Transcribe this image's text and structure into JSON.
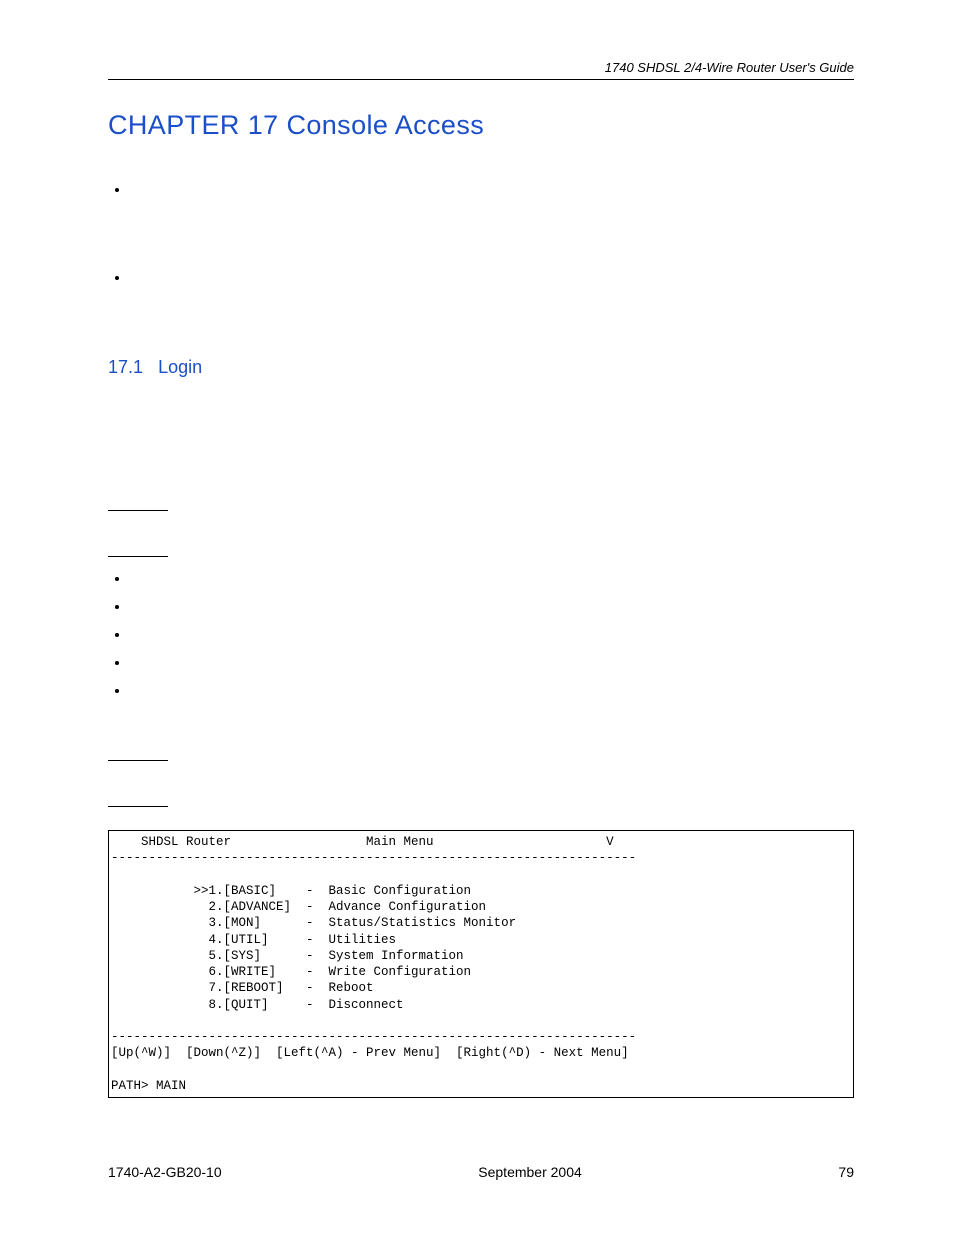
{
  "header": {
    "guide_title": "1740 SHDSL 2/4-Wire Router User's Guide"
  },
  "chapter": {
    "title": "CHAPTER 17   Console Access"
  },
  "section": {
    "number": "17.1",
    "title": "Login"
  },
  "terminal": {
    "device": "SHDSL Router",
    "menu_title": "Main Menu",
    "right_char": "V",
    "divider": "----------------------------------------------------------------------",
    "items": [
      {
        "num": "1",
        "tag": "[BASIC]",
        "desc": "Basic Configuration",
        "sel": true
      },
      {
        "num": "2",
        "tag": "[ADVANCE]",
        "desc": "Advance Configuration",
        "sel": false
      },
      {
        "num": "3",
        "tag": "[MON]",
        "desc": "Status/Statistics Monitor",
        "sel": false
      },
      {
        "num": "4",
        "tag": "[UTIL]",
        "desc": "Utilities",
        "sel": false
      },
      {
        "num": "5",
        "tag": "[SYS]",
        "desc": "System Information",
        "sel": false
      },
      {
        "num": "6",
        "tag": "[WRITE]",
        "desc": "Write Configuration",
        "sel": false
      },
      {
        "num": "7",
        "tag": "[REBOOT]",
        "desc": "Reboot",
        "sel": false
      },
      {
        "num": "8",
        "tag": "[QUIT]",
        "desc": "Disconnect",
        "sel": false
      }
    ],
    "nav_hint": "[Up(^W)]  [Down(^Z)]  [Left(^A) - Prev Menu]  [Right(^D) - Next Menu]",
    "path": "PATH> MAIN"
  },
  "footer": {
    "doc_code": "1740-A2-GB20-10",
    "date": "September 2004",
    "page": "79"
  }
}
